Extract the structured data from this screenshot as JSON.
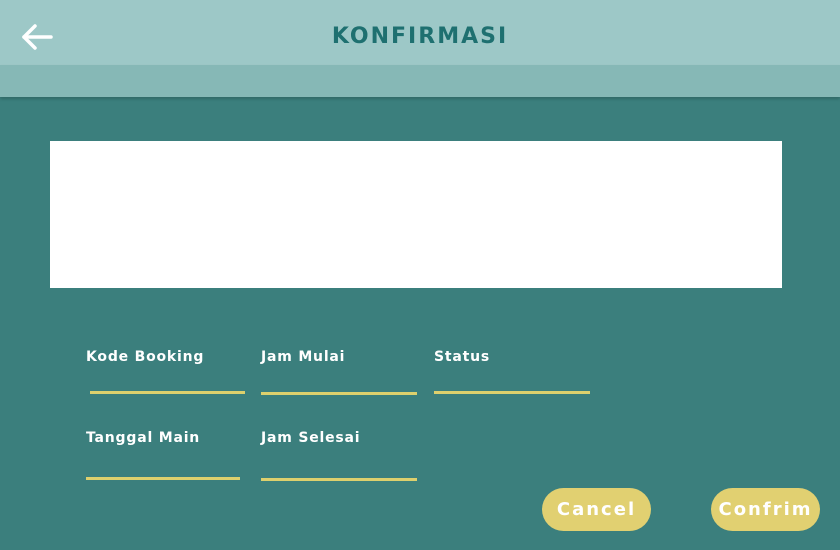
{
  "header": {
    "title": "KONFIRMASI",
    "back_icon": "arrow-left-icon"
  },
  "fields": {
    "kode_booking": {
      "label": "Kode Booking",
      "value": ""
    },
    "jam_mulai": {
      "label": "Jam Mulai",
      "value": ""
    },
    "status": {
      "label": "Status",
      "value": ""
    },
    "tanggal_main": {
      "label": "Tanggal Main",
      "value": ""
    },
    "jam_selesai": {
      "label": "Jam Selesai",
      "value": ""
    }
  },
  "actions": {
    "cancel_label": "Cancel",
    "confirm_label": "Confrim"
  },
  "colors": {
    "header": "#9dc8c7",
    "subheader": "#86b8b6",
    "background": "#3b7f7d",
    "title": "#1e7070",
    "underline": "#ddd06d",
    "button": "#e1d071"
  }
}
